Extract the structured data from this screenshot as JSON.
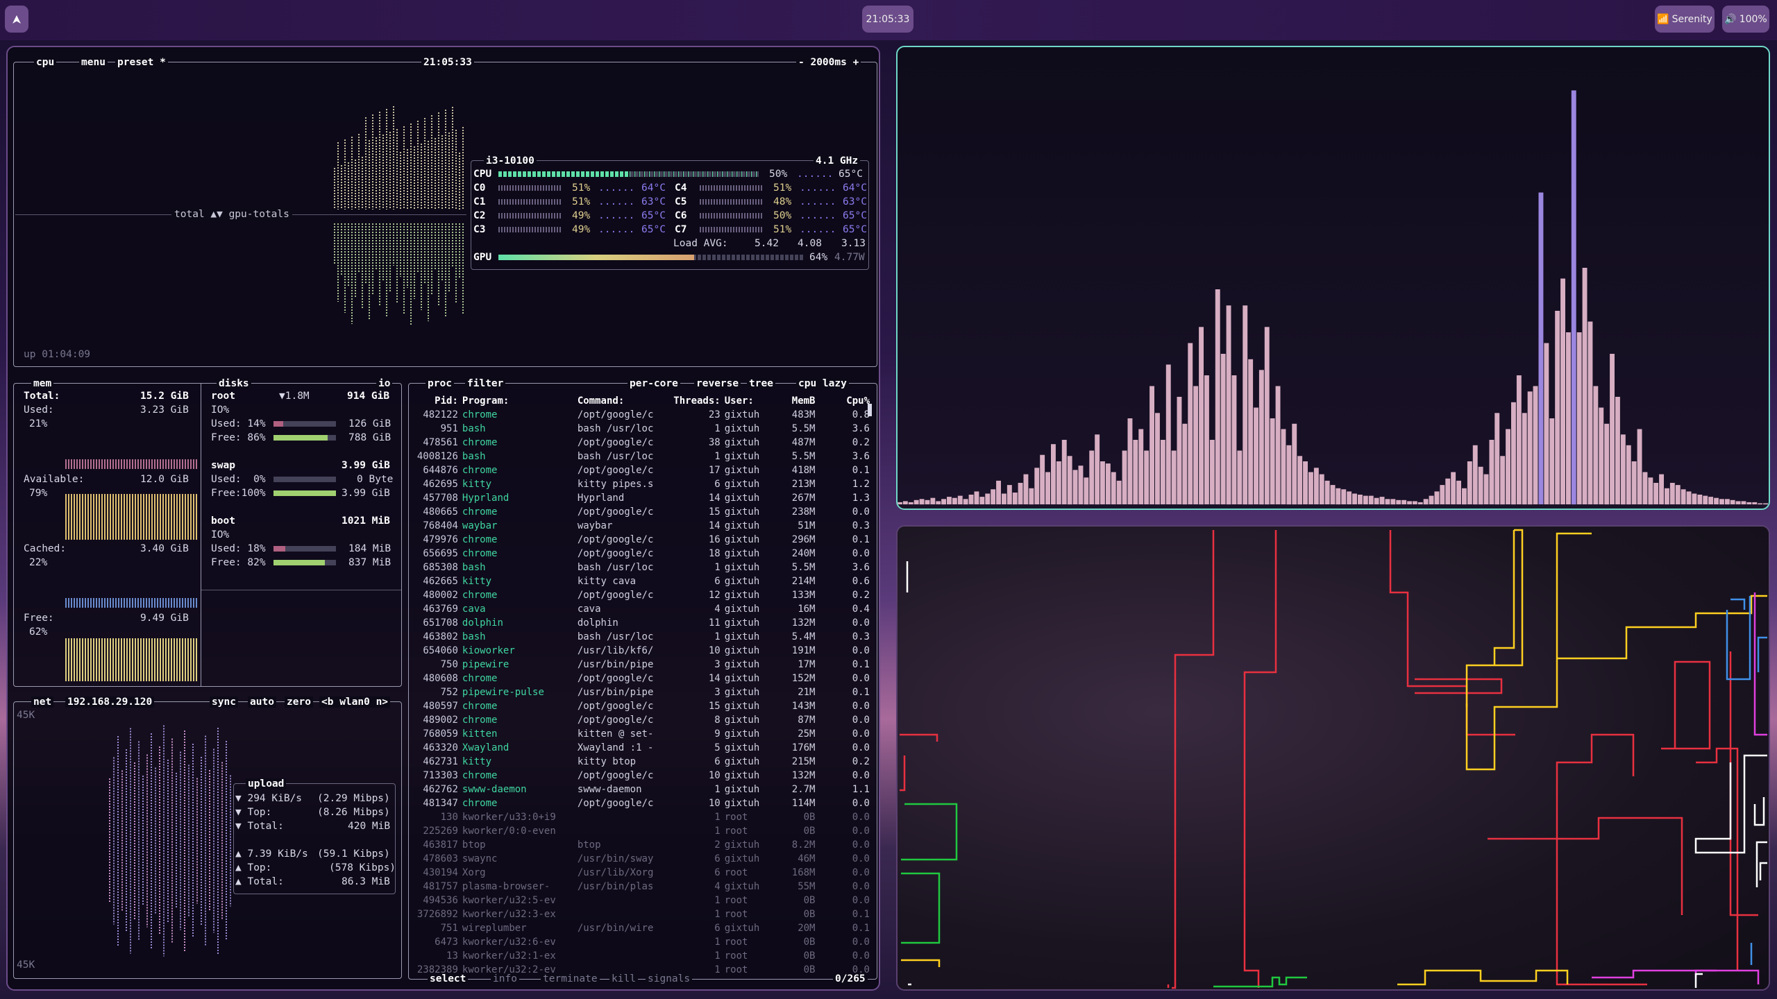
{
  "topbar": {
    "clock": "21:05:33",
    "wifi": "Serenity",
    "volume": "100%"
  },
  "btop": {
    "cpu_box": {
      "title": "cpu",
      "menu": "menu",
      "preset": "preset *",
      "time": "21:05:33",
      "refresh": "- 2000ms +",
      "total_label": "total ▲▼ gpu-totals",
      "uptime": "up 01:04:09",
      "info": {
        "model": "i3-10100",
        "freq": "4.1 GHz",
        "cpu_pct": "50%",
        "cpu_temp": "65°C",
        "cores": [
          {
            "n": "C0",
            "p": "51%",
            "t": "64°C"
          },
          {
            "n": "C1",
            "p": "51%",
            "t": "63°C"
          },
          {
            "n": "C2",
            "p": "49%",
            "t": "65°C"
          },
          {
            "n": "C3",
            "p": "49%",
            "t": "65°C"
          },
          {
            "n": "C4",
            "p": "51%",
            "t": "64°C"
          },
          {
            "n": "C5",
            "p": "48%",
            "t": "63°C"
          },
          {
            "n": "C6",
            "p": "50%",
            "t": "65°C"
          },
          {
            "n": "C7",
            "p": "51%",
            "t": "65°C"
          }
        ],
        "load_label": "Load AVG:",
        "load": [
          "5.42",
          "4.08",
          "3.13"
        ],
        "gpu_pct": "64%",
        "gpu_watts": "4.77W"
      }
    },
    "mem_box": {
      "title": "mem",
      "total_label": "Total:",
      "total": "15.2 GiB",
      "used_label": "Used:",
      "used": "3.23 GiB",
      "used_pct": "21%",
      "avail_label": "Available:",
      "avail": "12.0 GiB",
      "avail_pct": "79%",
      "cached_label": "Cached:",
      "cached": "3.40 GiB",
      "cached_pct": "22%",
      "free_label": "Free:",
      "free": "9.49 GiB",
      "free_pct": "62%"
    },
    "disks_box": {
      "title": "disks",
      "io": "io",
      "root": {
        "name": "root",
        "io_rate": "▼1.8M",
        "size": "914 GiB",
        "io_label": "IO%",
        "used": "Used: 14%",
        "used_v": "126 GiB",
        "free": "Free: 86%",
        "free_v": "788 GiB"
      },
      "swap": {
        "name": "swap",
        "size": "3.99 GiB",
        "used": "Used:  0%",
        "used_v": "0 Byte",
        "free": "Free:100%",
        "free_v": "3.99 GiB"
      },
      "boot": {
        "name": "boot",
        "size": "1021 MiB",
        "io_label": "IO%",
        "used": "Used: 18%",
        "used_v": "184 MiB",
        "free": "Free: 82%",
        "free_v": "837 MiB"
      }
    },
    "net_box": {
      "title": "net",
      "ip": "192.168.29.120",
      "sync": "sync",
      "auto": "auto",
      "zero": "zero",
      "iface": "<b wlan0 n>",
      "scale_top": "45K",
      "scale_bot": "45K",
      "upload_title": "upload",
      "download_rate": "▼ 294 KiB/s",
      "download_bits": "(2.29 Mibps)",
      "dl_top": "▼ Top:",
      "dl_top_v": "(8.26 Mibps)",
      "dl_total": "▼ Total:",
      "dl_total_v": "420 MiB",
      "upload_rate": "▲ 7.39 KiB/s",
      "upload_bits": "(59.1 Kibps)",
      "ul_top": "▲ Top:",
      "ul_top_v": "(578 Kibps)",
      "ul_total": "▲ Total:",
      "ul_total_v": "86.3 MiB"
    },
    "proc_box": {
      "title": "proc",
      "filter": "filter",
      "per_core": "per-core",
      "reverse": "reverse",
      "tree": "tree",
      "sort": "cpu lazy",
      "columns": [
        "Pid:",
        "Program:",
        "Command:",
        "Threads:",
        "User:",
        "MemB",
        "Cpu%"
      ],
      "rows": [
        [
          "482122",
          "chrome",
          "/opt/google/c",
          "23",
          "gixtuh",
          "483M",
          "0.8"
        ],
        [
          "951",
          "bash",
          "bash /usr/loc",
          "1",
          "gixtuh",
          "5.5M",
          "3.6"
        ],
        [
          "478561",
          "chrome",
          "/opt/google/c",
          "38",
          "gixtuh",
          "487M",
          "0.2"
        ],
        [
          "4008126",
          "bash",
          "bash /usr/loc",
          "1",
          "gixtuh",
          "5.5M",
          "3.6"
        ],
        [
          "644876",
          "chrome",
          "/opt/google/c",
          "17",
          "gixtuh",
          "418M",
          "0.1"
        ],
        [
          "462695",
          "kitty",
          "kitty pipes.s",
          "6",
          "gixtuh",
          "213M",
          "1.2"
        ],
        [
          "457708",
          "Hyprland",
          "Hyprland",
          "14",
          "gixtuh",
          "267M",
          "1.3"
        ],
        [
          "480665",
          "chrome",
          "/opt/google/c",
          "15",
          "gixtuh",
          "238M",
          "0.0"
        ],
        [
          "768404",
          "waybar",
          "waybar",
          "14",
          "gixtuh",
          "51M",
          "0.3"
        ],
        [
          "479976",
          "chrome",
          "/opt/google/c",
          "16",
          "gixtuh",
          "296M",
          "0.1"
        ],
        [
          "656695",
          "chrome",
          "/opt/google/c",
          "18",
          "gixtuh",
          "240M",
          "0.0"
        ],
        [
          "685308",
          "bash",
          "bash /usr/loc",
          "1",
          "gixtuh",
          "5.5M",
          "3.6"
        ],
        [
          "462665",
          "kitty",
          "kitty cava",
          "6",
          "gixtuh",
          "214M",
          "0.6"
        ],
        [
          "480002",
          "chrome",
          "/opt/google/c",
          "12",
          "gixtuh",
          "133M",
          "0.2"
        ],
        [
          "463769",
          "cava",
          "cava",
          "4",
          "gixtuh",
          "16M",
          "0.4"
        ],
        [
          "651708",
          "dolphin",
          "dolphin",
          "11",
          "gixtuh",
          "132M",
          "0.0"
        ],
        [
          "463802",
          "bash",
          "bash /usr/loc",
          "1",
          "gixtuh",
          "5.4M",
          "0.3"
        ],
        [
          "654060",
          "kioworker",
          "/usr/lib/kf6/",
          "10",
          "gixtuh",
          "191M",
          "0.0"
        ],
        [
          "750",
          "pipewire",
          "/usr/bin/pipe",
          "3",
          "gixtuh",
          "17M",
          "0.1"
        ],
        [
          "480608",
          "chrome",
          "/opt/google/c",
          "14",
          "gixtuh",
          "152M",
          "0.0"
        ],
        [
          "752",
          "pipewire-pulse",
          "/usr/bin/pipe",
          "3",
          "gixtuh",
          "21M",
          "0.1"
        ],
        [
          "480597",
          "chrome",
          "/opt/google/c",
          "15",
          "gixtuh",
          "143M",
          "0.0"
        ],
        [
          "489002",
          "chrome",
          "/opt/google/c",
          "8",
          "gixtuh",
          "87M",
          "0.0"
        ],
        [
          "768059",
          "kitten",
          "kitten @ set-",
          "9",
          "gixtuh",
          "25M",
          "0.0"
        ],
        [
          "463320",
          "Xwayland",
          "Xwayland :1 -",
          "5",
          "gixtuh",
          "176M",
          "0.0"
        ],
        [
          "462731",
          "kitty",
          "kitty btop",
          "6",
          "gixtuh",
          "215M",
          "0.2"
        ],
        [
          "713303",
          "chrome",
          "/opt/google/c",
          "10",
          "gixtuh",
          "132M",
          "0.0"
        ],
        [
          "462762",
          "swww-daemon",
          "swww-daemon",
          "1",
          "gixtuh",
          "2.7M",
          "1.1"
        ],
        [
          "481347",
          "chrome",
          "/opt/google/c",
          "10",
          "gixtuh",
          "114M",
          "0.0"
        ],
        [
          "130",
          "kworker/u33:0+i9",
          "",
          "1",
          "root",
          "0B",
          "0.0"
        ],
        [
          "225269",
          "kworker/0:0-even",
          "",
          "1",
          "root",
          "0B",
          "0.0"
        ],
        [
          "463817",
          "btop",
          "btop",
          "2",
          "gixtuh",
          "8.2M",
          "0.0"
        ],
        [
          "478603",
          "swaync",
          "/usr/bin/sway",
          "6",
          "gixtuh",
          "46M",
          "0.0"
        ],
        [
          "430194",
          "Xorg",
          "/usr/lib/Xorg",
          "6",
          "root",
          "168M",
          "0.0"
        ],
        [
          "481757",
          "plasma-browser-",
          "/usr/bin/plas",
          "4",
          "gixtuh",
          "55M",
          "0.0"
        ],
        [
          "494536",
          "kworker/u32:5-ev",
          "",
          "1",
          "root",
          "0B",
          "0.0"
        ],
        [
          "3726892",
          "kworker/u32:3-ex",
          "",
          "1",
          "root",
          "0B",
          "0.1"
        ],
        [
          "751",
          "wireplumber",
          "/usr/bin/wire",
          "6",
          "gixtuh",
          "20M",
          "0.1"
        ],
        [
          "6473",
          "kworker/u32:6-ev",
          "",
          "1",
          "root",
          "0B",
          "0.0"
        ],
        [
          "13",
          "kworker/u32:1-ex",
          "",
          "1",
          "root",
          "0B",
          "0.0"
        ],
        [
          "2382389",
          "kworker/u32:2-ev",
          "",
          "1",
          "root",
          "0B",
          "0.0"
        ]
      ],
      "footer_select": "select",
      "footer_info": "info",
      "footer_terminate": "terminate",
      "footer_kill": "kill",
      "footer_signals": "signals",
      "count": "0/265"
    }
  },
  "colors": {
    "accent": "#8c7cf0",
    "green": "#5fe0a8",
    "cava_bar": "#d7aec2",
    "border": "#9a9ab0"
  },
  "cava": {
    "bars": [
      2,
      3,
      2,
      4,
      5,
      4,
      6,
      3,
      5,
      7,
      6,
      8,
      5,
      9,
      12,
      7,
      10,
      14,
      22,
      10,
      18,
      11,
      20,
      28,
      15,
      34,
      46,
      30,
      56,
      40,
      60,
      45,
      32,
      36,
      25,
      50,
      65,
      40,
      38,
      30,
      22,
      50,
      80,
      60,
      70,
      50,
      110,
      85,
      60,
      130,
      50,
      100,
      75,
      150,
      110,
      165,
      120,
      60,
      200,
      140,
      185,
      120,
      50,
      185,
      135,
      90,
      125,
      165,
      80,
      110,
      70,
      55,
      75,
      45,
      40,
      30,
      34,
      28,
      22,
      18,
      15,
      14,
      12,
      10,
      9,
      8,
      8,
      6,
      7,
      5,
      5,
      4,
      4,
      3,
      3,
      2,
      5,
      8,
      12,
      18,
      24,
      30,
      22,
      15,
      40,
      55,
      35,
      28,
      60,
      85,
      45,
      70,
      95,
      120,
      85,
      105,
      110,
      290,
      150,
      80,
      180,
      210,
      160,
      385,
      160,
      220,
      170,
      110,
      90,
      75,
      140,
      100,
      65,
      55,
      40,
      70,
      30,
      25,
      20,
      28,
      15,
      20,
      18,
      14,
      12,
      10,
      9,
      8,
      7,
      6,
      5,
      5,
      4,
      3,
      3,
      2,
      2,
      1,
      1
    ]
  }
}
